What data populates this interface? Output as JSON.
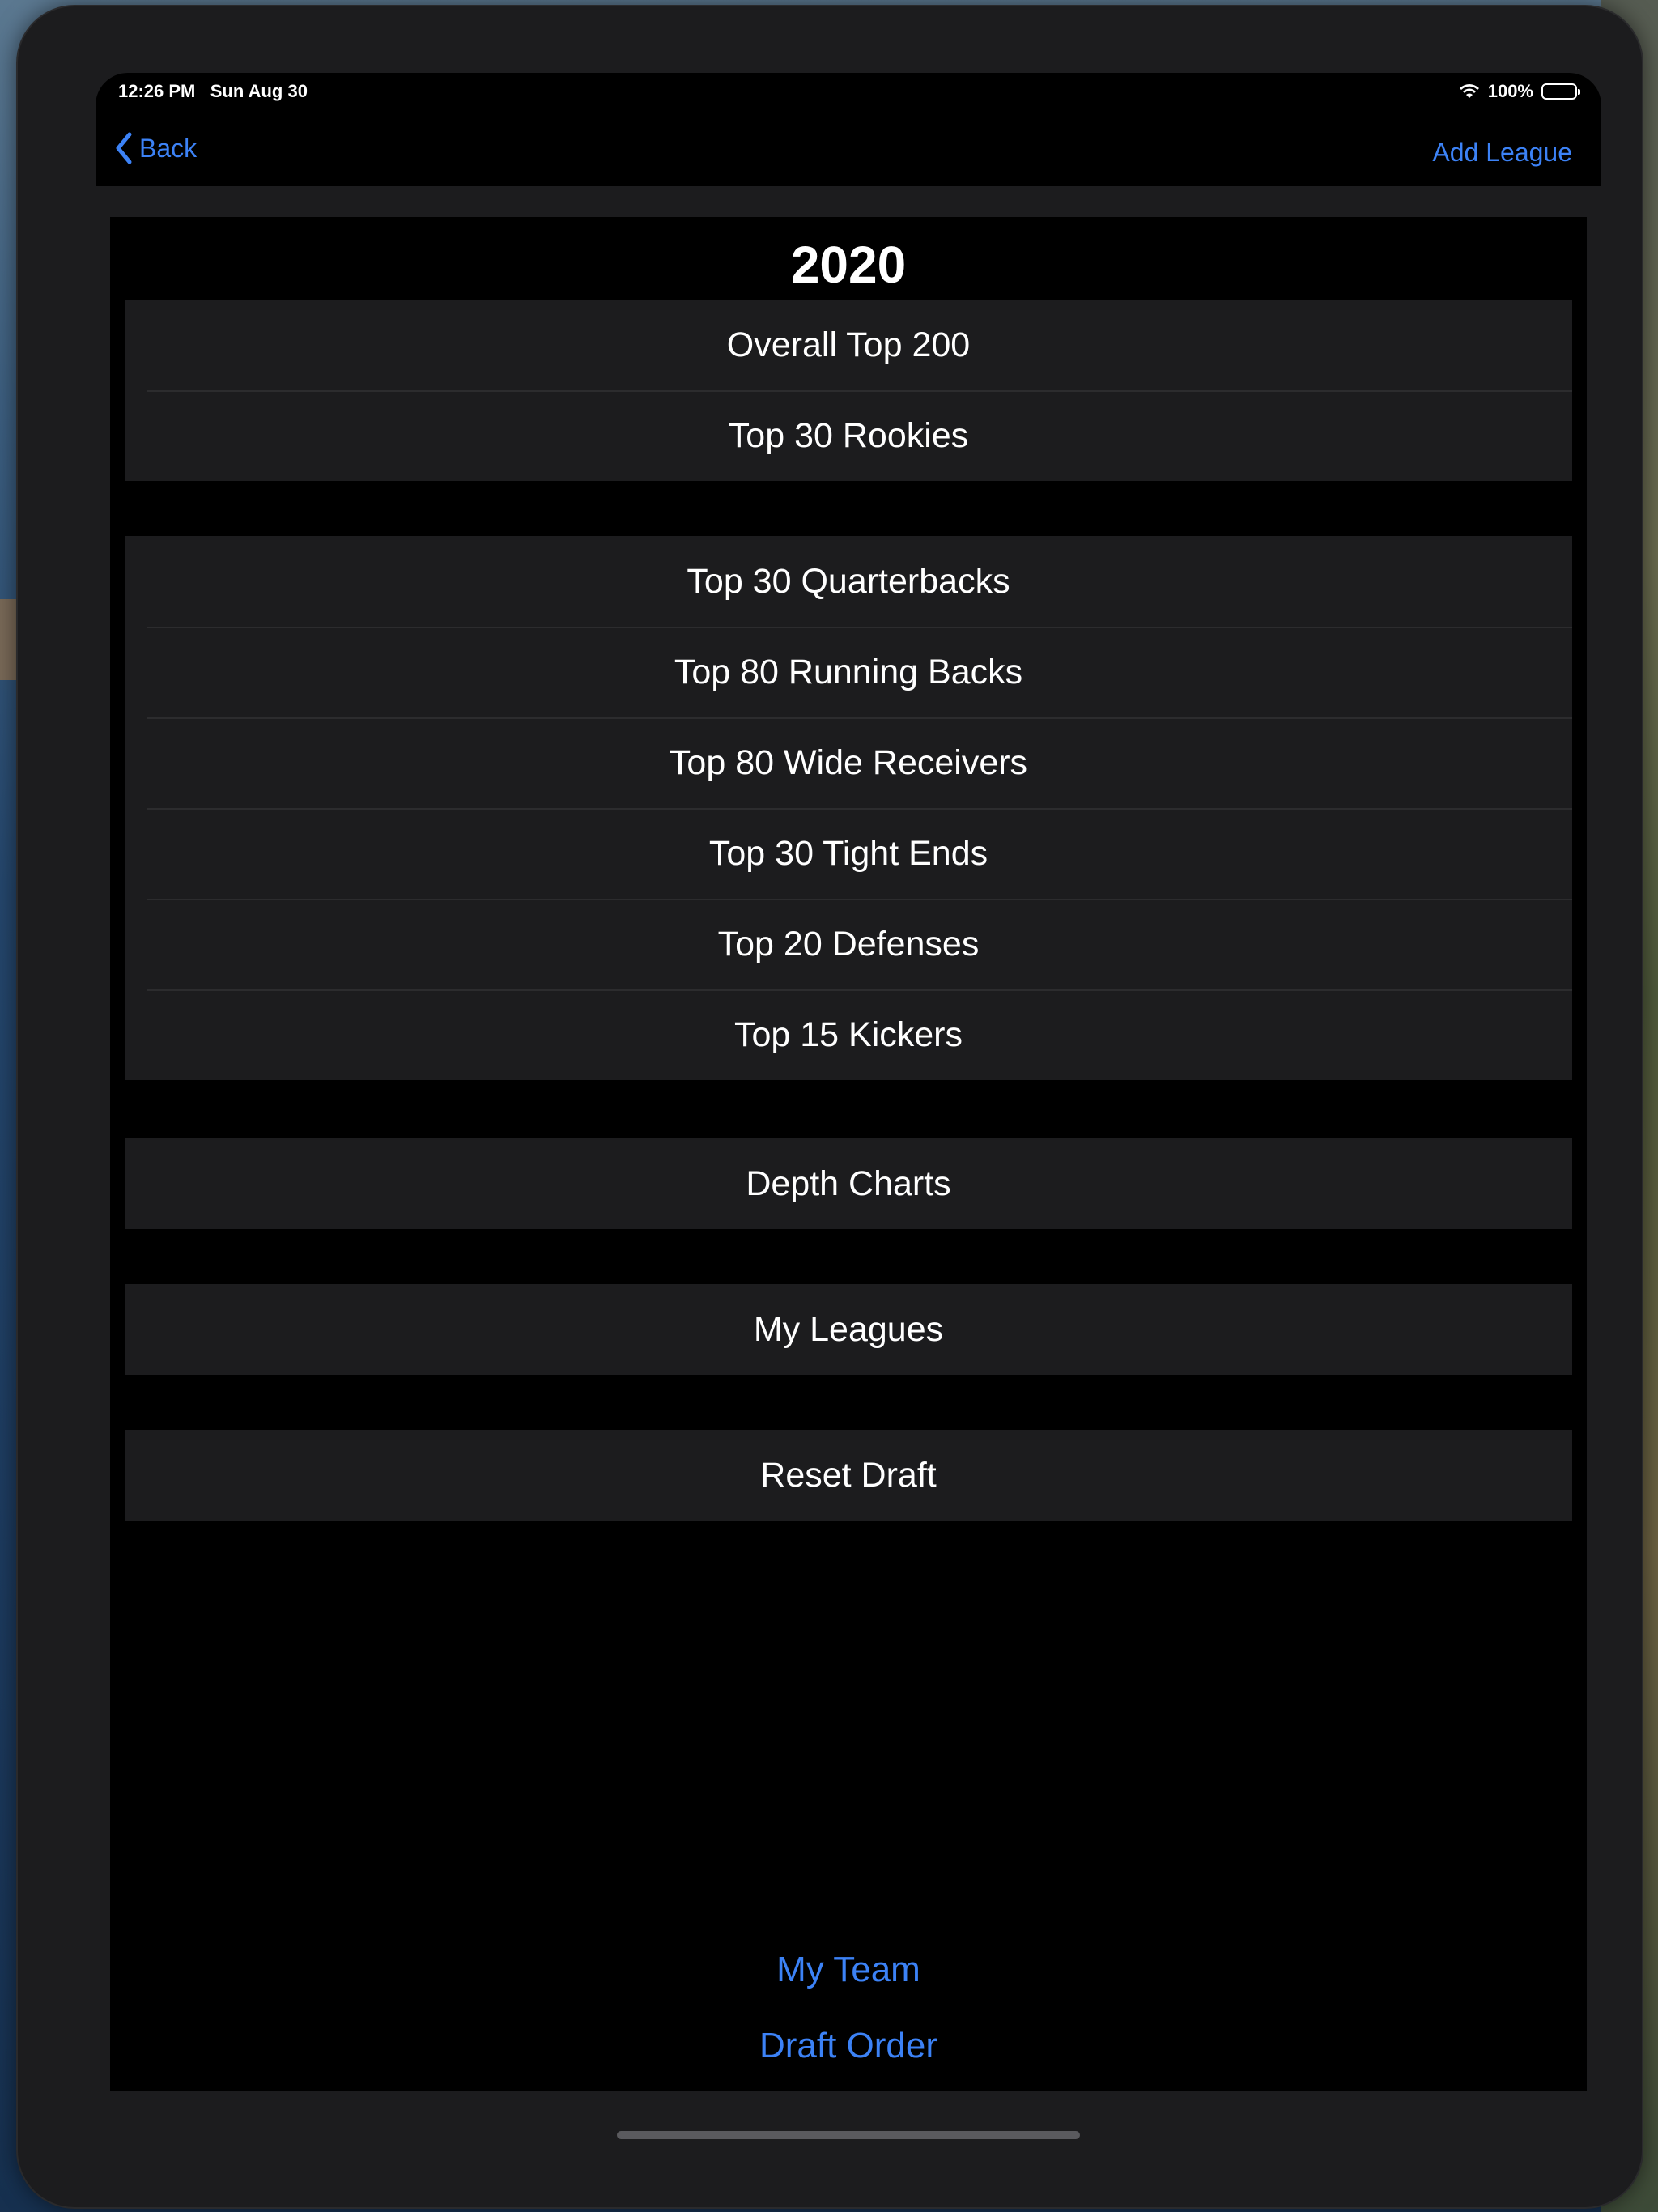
{
  "status_bar": {
    "time": "12:26 PM",
    "date": "Sun Aug 30",
    "battery": "100%",
    "icons": [
      "wifi-icon",
      "battery-icon"
    ]
  },
  "nav": {
    "back_label": "Back",
    "add_label": "Add League",
    "back_icon": "chevron-left-icon"
  },
  "title": "2020",
  "groups": [
    {
      "rows": [
        "Overall Top 200",
        "Top 30 Rookies"
      ]
    },
    {
      "rows": [
        "Top 30 Quarterbacks",
        "Top 80 Running Backs",
        "Top 80 Wide Receivers",
        "Top 30 Tight Ends",
        "Top 20 Defenses",
        "Top 15 Kickers"
      ]
    },
    {
      "rows": [
        "Depth Charts"
      ]
    },
    {
      "rows": [
        "My Leagues"
      ]
    },
    {
      "rows": [
        "Reset Draft"
      ]
    }
  ],
  "footer": {
    "my_team": "My Team",
    "draft_order": "Draft Order"
  },
  "colors": {
    "accent": "#3c82f6",
    "cell_bg": "#1c1c1e",
    "background": "#000000"
  }
}
